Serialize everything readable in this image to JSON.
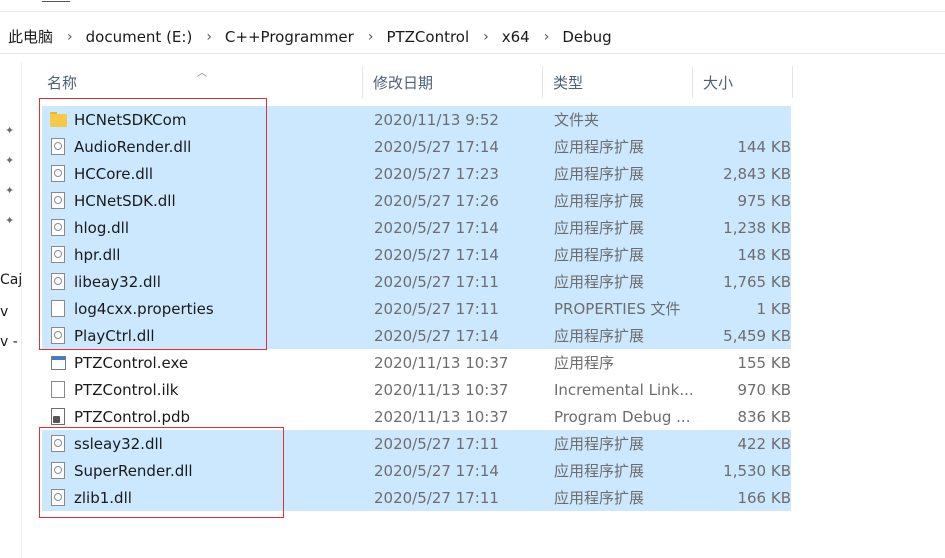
{
  "breadcrumb": [
    {
      "label": "此电脑"
    },
    {
      "label": "document (E:)"
    },
    {
      "label": "C++Programmer"
    },
    {
      "label": "PTZControl"
    },
    {
      "label": "x64"
    },
    {
      "label": "Debug"
    }
  ],
  "nav_fragments": [
    "Caj",
    "v",
    "v -"
  ],
  "columns": {
    "name": "名称",
    "date": "修改日期",
    "type": "类型",
    "size": "大小"
  },
  "files": [
    {
      "name": "HCNetSDKCom",
      "date": "2020/11/13 9:52",
      "type": "文件夹",
      "size": "",
      "icon": "folder-icon",
      "selected": true
    },
    {
      "name": "AudioRender.dll",
      "date": "2020/5/27 17:14",
      "type": "应用程序扩展",
      "size": "144 KB",
      "icon": "dll-file-icon",
      "selected": true
    },
    {
      "name": "HCCore.dll",
      "date": "2020/5/27 17:23",
      "type": "应用程序扩展",
      "size": "2,843 KB",
      "icon": "dll-file-icon",
      "selected": true
    },
    {
      "name": "HCNetSDK.dll",
      "date": "2020/5/27 17:26",
      "type": "应用程序扩展",
      "size": "975 KB",
      "icon": "dll-file-icon",
      "selected": true
    },
    {
      "name": "hlog.dll",
      "date": "2020/5/27 17:14",
      "type": "应用程序扩展",
      "size": "1,238 KB",
      "icon": "dll-file-icon",
      "selected": true
    },
    {
      "name": "hpr.dll",
      "date": "2020/5/27 17:14",
      "type": "应用程序扩展",
      "size": "148 KB",
      "icon": "dll-file-icon",
      "selected": true
    },
    {
      "name": "libeay32.dll",
      "date": "2020/5/27 17:11",
      "type": "应用程序扩展",
      "size": "1,765 KB",
      "icon": "dll-file-icon",
      "selected": true
    },
    {
      "name": "log4cxx.properties",
      "date": "2020/5/27 17:11",
      "type": "PROPERTIES 文件",
      "size": "1 KB",
      "icon": "blank-file-icon",
      "selected": true
    },
    {
      "name": "PlayCtrl.dll",
      "date": "2020/5/27 17:14",
      "type": "应用程序扩展",
      "size": "5,459 KB",
      "icon": "dll-file-icon",
      "selected": true
    },
    {
      "name": "PTZControl.exe",
      "date": "2020/11/13 10:37",
      "type": "应用程序",
      "size": "155 KB",
      "icon": "exe-file-icon",
      "selected": false
    },
    {
      "name": "PTZControl.ilk",
      "date": "2020/11/13 10:37",
      "type": "Incremental Link...",
      "size": "970 KB",
      "icon": "blank-file-icon",
      "selected": false
    },
    {
      "name": "PTZControl.pdb",
      "date": "2020/11/13 10:37",
      "type": "Program Debug ...",
      "size": "836 KB",
      "icon": "pdb-file-icon",
      "selected": false
    },
    {
      "name": "ssleay32.dll",
      "date": "2020/5/27 17:11",
      "type": "应用程序扩展",
      "size": "422 KB",
      "icon": "dll-file-icon",
      "selected": true
    },
    {
      "name": "SuperRender.dll",
      "date": "2020/5/27 17:14",
      "type": "应用程序扩展",
      "size": "1,530 KB",
      "icon": "dll-file-icon",
      "selected": true
    },
    {
      "name": "zlib1.dll",
      "date": "2020/5/27 17:11",
      "type": "应用程序扩展",
      "size": "166 KB",
      "icon": "dll-file-icon",
      "selected": true
    }
  ],
  "colors": {
    "selection": "#cce8ff",
    "annotation": "#e03030",
    "header_text": "#4c607a"
  }
}
